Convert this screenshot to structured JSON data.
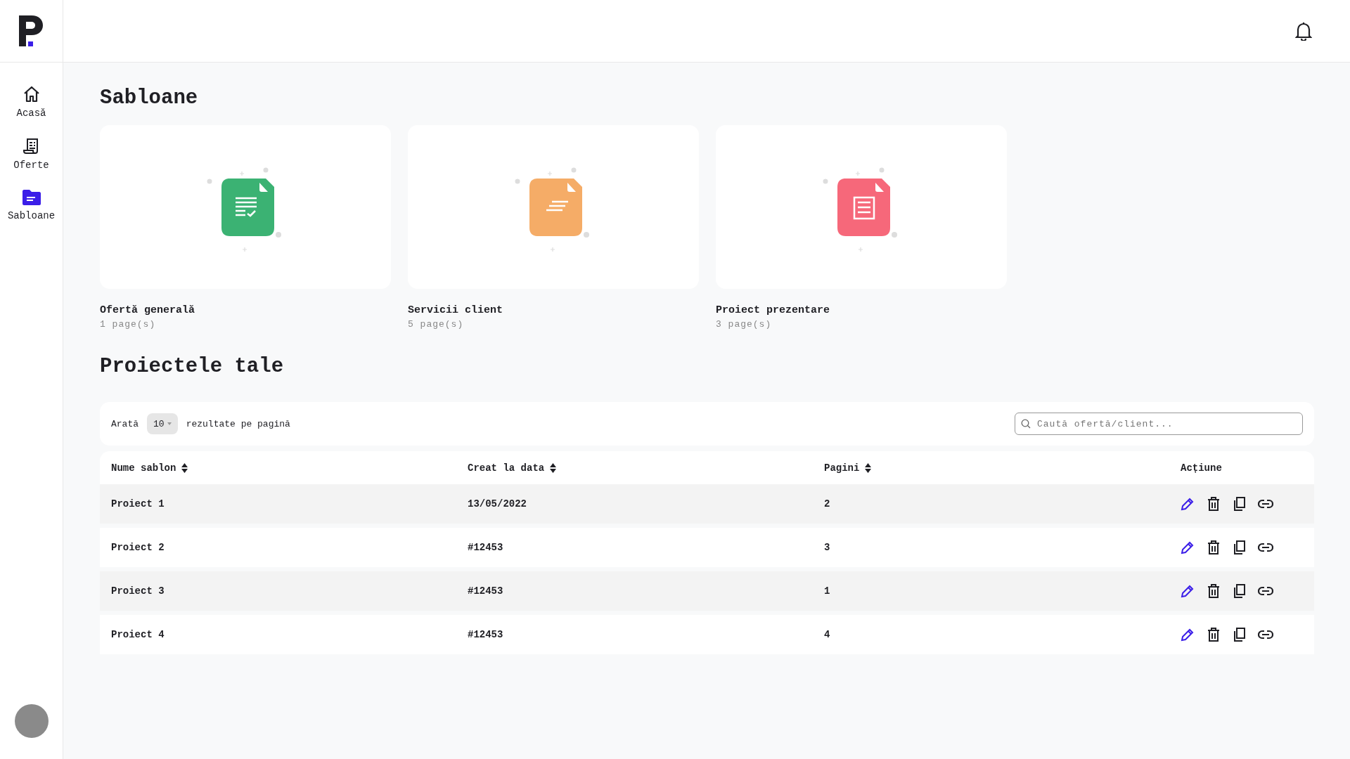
{
  "sidebar": {
    "items": [
      {
        "label": "Acasă",
        "kind": "home",
        "selected": false
      },
      {
        "label": "Oferte",
        "kind": "receipt",
        "selected": false
      },
      {
        "label": "Sabloane",
        "kind": "folder",
        "selected": true
      }
    ]
  },
  "templates": {
    "title": "Sabloane",
    "cards": [
      {
        "name": "Ofertă generală",
        "pages": "1 page(s)",
        "color": "#3bb273",
        "kind": "checklist"
      },
      {
        "name": "Servicii client",
        "pages": "5 page(s)",
        "color": "#f5ac67",
        "kind": "lines"
      },
      {
        "name": "Proiect prezentare",
        "pages": "3 page(s)",
        "color": "#f6687a",
        "kind": "receipt"
      }
    ]
  },
  "projects": {
    "title": "Proiectele tale",
    "toolbar": {
      "show_label": "Arată",
      "page_size": "10",
      "per_page_label": "rezultate pe pagină",
      "search": {
        "placeholder": "Caută ofertă/client..."
      }
    },
    "table": {
      "columns": [
        {
          "label": "Nume sablon",
          "sortable": true
        },
        {
          "label": "Creat la data",
          "sortable": true
        },
        {
          "label": "Pagini",
          "sortable": true
        },
        {
          "label": "Acțiune",
          "sortable": false
        }
      ],
      "rows": [
        [
          "Proiect 1",
          "13/05/2022",
          "2"
        ],
        [
          "Proiect 2",
          "#12453",
          "3"
        ],
        [
          "Proiect 3",
          "#12453",
          "1"
        ],
        [
          "Proiect 4",
          "#12453",
          "4"
        ]
      ]
    }
  }
}
